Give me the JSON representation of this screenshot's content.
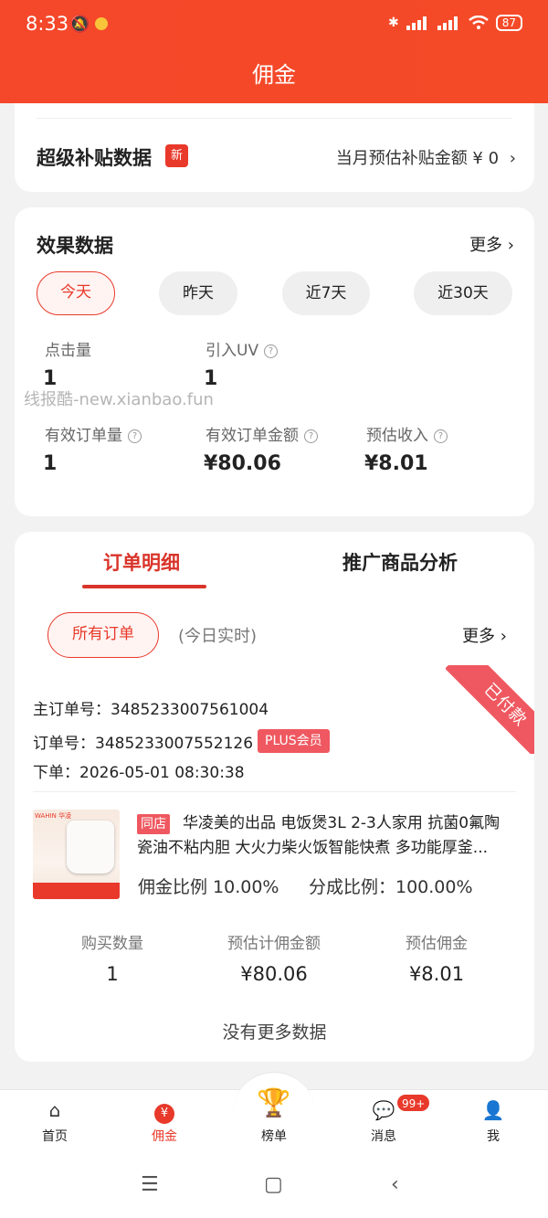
{
  "status_bar": {
    "time": "8:33",
    "battery": "87"
  },
  "header": {
    "title": "佣金"
  },
  "subsidy": {
    "title": "超级补贴数据",
    "badge": "新",
    "summary": "当月预估补贴金额 ¥ 0"
  },
  "effect": {
    "title": "效果数据",
    "more": "更多",
    "ranges": [
      "今天",
      "昨天",
      "近7天",
      "近30天"
    ],
    "selected_range": "今天",
    "metrics": {
      "clicks_label": "点击量",
      "clicks_value": "1",
      "uv_label": "引入UV",
      "uv_value": "1",
      "orders_label": "有效订单量",
      "orders_value": "1",
      "amount_label": "有效订单金额",
      "amount_value": "¥80.06",
      "income_label": "预估收入",
      "income_value": "¥8.01"
    }
  },
  "watermark": "线报酷-new.xianbao.fun",
  "orders": {
    "tabs": [
      "订单明细",
      "推广商品分析"
    ],
    "active_tab": "订单明细",
    "filter": "所有订单",
    "filter_note": "(今日实时)",
    "more": "更多",
    "status": "已付款",
    "main_order": "主订单号：3485233007561004",
    "order": "订单号：3485233007552126",
    "plus_badge": "PLUS会员",
    "placed": "下单：2026-05-01 08:30:38",
    "product": {
      "store_tag": "同店",
      "title": "华凌美的出品 电饭煲3L 2-3人家用 抗菌0氟陶瓷油不粘内胆 大火力柴火饭智能快煮 多功能厚釜...",
      "commission_rate": "佣金比例 10.00%",
      "share_rate": "分成比例：100.00%",
      "thumb_brand": "WAHIN 华凌"
    },
    "stats": {
      "qty_label": "购买数量",
      "qty_value": "1",
      "base_label": "预估计佣金额",
      "base_value": "¥80.06",
      "commission_label": "预估佣金",
      "commission_value": "¥8.01"
    },
    "no_more": "没有更多数据"
  },
  "tabbar": {
    "items": [
      "首页",
      "佣金",
      "榜单",
      "消息",
      "我"
    ],
    "active": "佣金",
    "message_badge": "99+"
  },
  "colors": {
    "brand": "#f5472a",
    "accent_red": "#e8392a",
    "ribbon": "#ef5860"
  }
}
